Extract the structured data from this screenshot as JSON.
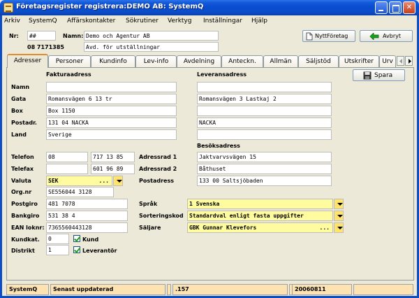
{
  "window": {
    "title": "Företagsregister registrera:DEMO AB: SystemQ",
    "minimize": "",
    "maximize": "",
    "close": "✕"
  },
  "menu": [
    "Arkiv",
    "SystemQ",
    "Affärskontakter",
    "Sökrutiner",
    "Verktyg",
    "Inställningar",
    "Hjälp"
  ],
  "header": {
    "nr_label": "Nr:",
    "nr_value": "##",
    "phone": "08 7171385",
    "namn_label": "Namn:",
    "namn_value": "Demo och Agentur AB",
    "namn2_value": "Avd. för utställningar",
    "new_company_button": "NyttFöretag",
    "cancel_button": "Avbryt"
  },
  "tabs": [
    "Adresser",
    "Personer",
    "Kundinfo",
    "Lev-info",
    "Avdelning",
    "Anteckn.",
    "Allmän",
    "Säljstöd",
    "Utskrifter",
    "Urv"
  ],
  "active_tab": "Adresser",
  "save_button": "Spara",
  "faktura": {
    "heading": "Fakturaadress",
    "labels": [
      "Namn",
      "Gata",
      "Box",
      "Postadr.",
      "Land"
    ],
    "values": [
      "",
      "Romansvägen 6 13 tr",
      "Box 1150",
      "131 04 NACKA",
      "Sverige"
    ]
  },
  "leverans": {
    "heading": "Leveransadress",
    "values": [
      "",
      "Romansvägen 3 Lastkaj 2",
      "",
      "NACKA",
      ""
    ]
  },
  "besok": {
    "heading": "Besöksadress",
    "labels": [
      "Adressrad 1",
      "Adressrad 2",
      "Postadress"
    ],
    "values": [
      "Jaktvarvsvägen 15",
      "Båthuset",
      "133 00 Saltsjöbaden"
    ]
  },
  "contact": {
    "telefon_label": "Telefon",
    "telefon_area": "08",
    "telefon_number": "717 13 85",
    "telefax_label": "Telefax",
    "telefax_area": "",
    "telefax_number": "601 96 89",
    "valuta_label": "Valuta",
    "valuta_value": "SEK",
    "valuta_dots": "...",
    "orgnr_label": "Org.nr",
    "orgnr_value": "SE556044 3128",
    "postgiro_label": "Postgiro",
    "postgiro_value": "481 7078",
    "bankgiro_label": "Bankgiro",
    "bankgiro_value": "531 38 4",
    "ean_label": "EAN loknr:",
    "ean_value": "7365560443128",
    "kundkat_label": "Kundkat.",
    "kundkat_value": "0",
    "kund_check_label": "Kund",
    "distrikt_label": "Distrikt",
    "distrikt_value": "1",
    "leverantor_check_label": "Leverantör"
  },
  "settings": {
    "sprak_label": "Språk",
    "sprak_value": "1 Svenska",
    "sortering_label": "Sorteringskod",
    "sortering_value": "Standardval enligt fasta uppgifter",
    "saljare_label": "Säljare",
    "saljare_value": "GBK   Gunnar Klevefors",
    "saljare_dots": "..."
  },
  "statusbar": [
    "SystemQ",
    "Senast uppdaterad",
    "",
    ".157",
    "",
    "20060811",
    ""
  ],
  "colors": {
    "titlebar": "#0A4CD1",
    "window_bg": "#ECE9D8",
    "highlight_field": "#FFFB9F",
    "status_bg": "#FDE2B2",
    "active_tab_accent": "#E68B2C"
  }
}
